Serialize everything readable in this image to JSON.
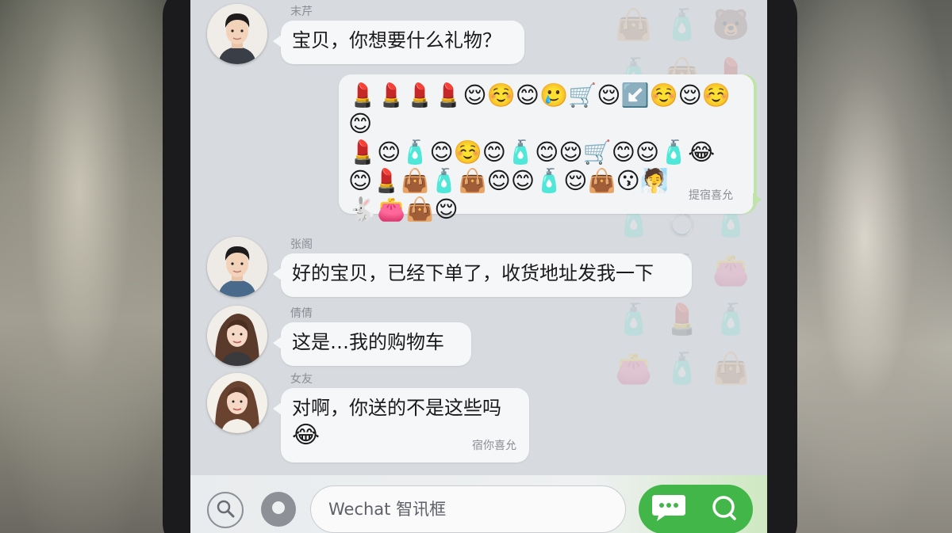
{
  "chat": {
    "messages": [
      {
        "sender": "末芹",
        "text": "宝贝，你想要什么礼物？"
      },
      {
        "sender": "",
        "emoji_rows": [
          "💄💄💄💄😌☺️😊🥲🛒😌↙️☺️😌☺️😊",
          "💄😊🧴😊☺️😊🧴😊😌🛒😊😌🧴😂",
          "😊💄👜🧴👜😊😊🧴😌👜😗🧖",
          "🐇👛👜😌"
        ],
        "timestamp": "提宿喜允"
      },
      {
        "sender": "张阁",
        "text": "好的宝贝，已经下单了，收货地址发我一下"
      },
      {
        "sender": "倩倩",
        "text": "这是…我的购物车"
      },
      {
        "sender": "女友",
        "text": "对啊，你送的不是这些吗",
        "emoji": "😂",
        "timestamp": "宿你喜允"
      }
    ]
  },
  "input": {
    "placeholder": "Wechat 智讯框"
  },
  "icons": {
    "voice": "voice-icon",
    "emoji": "emoji-icon",
    "chat": "chat-icon",
    "search": "search-icon"
  },
  "colors": {
    "accent": "#43b649",
    "bubble": "#f6f7f9",
    "screen_bg": "#d7dade"
  }
}
